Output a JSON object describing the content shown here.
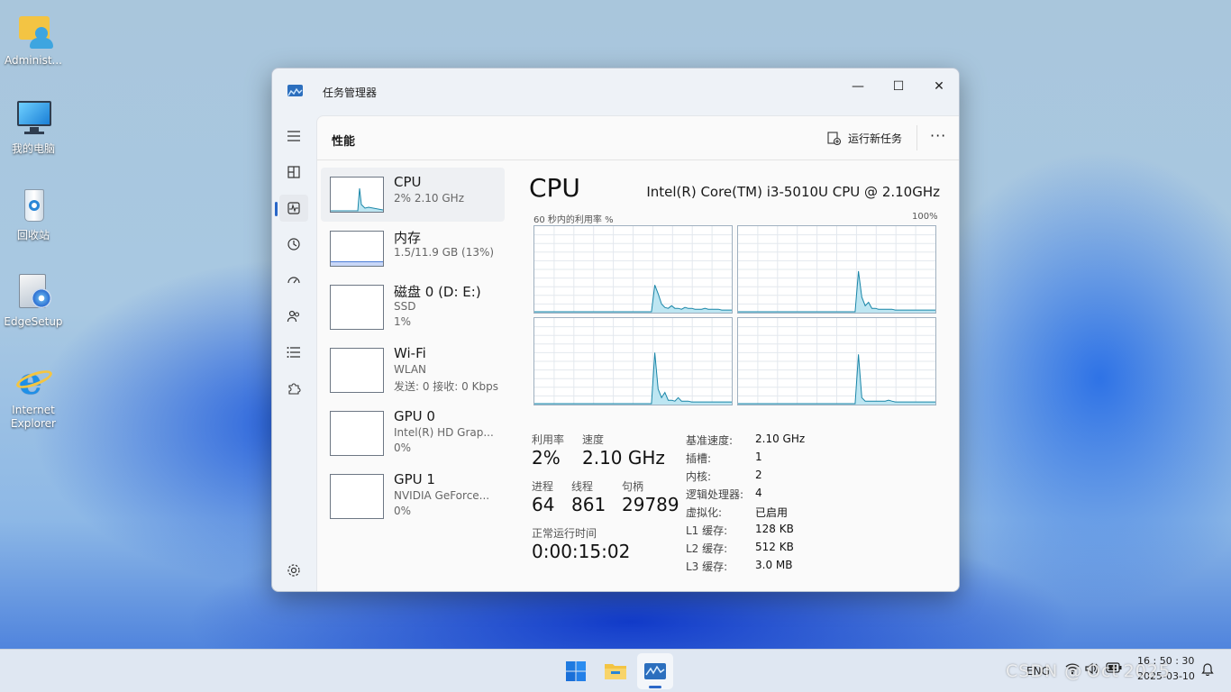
{
  "desktop": {
    "icons": [
      {
        "label": "Administ..."
      },
      {
        "label": "我的电脑"
      },
      {
        "label": "回收站"
      },
      {
        "label": "EdgeSetup"
      },
      {
        "label": "Internet Explorer"
      }
    ]
  },
  "window": {
    "title": "任务管理器",
    "controls": {
      "minimize": "—",
      "maximize": "☐",
      "close": "✕"
    }
  },
  "header": {
    "section_title": "性能",
    "run_new_task": "运行新任务",
    "more": "···"
  },
  "devices": [
    {
      "name": "CPU",
      "line1": "2% 2.10 GHz",
      "line2": ""
    },
    {
      "name": "内存",
      "line1": "1.5/11.9 GB (13%)",
      "line2": ""
    },
    {
      "name": "磁盘 0 (D: E:)",
      "line1": "SSD",
      "line2": "1%"
    },
    {
      "name": "Wi-Fi",
      "line1": "WLAN",
      "line2": "发送: 0 接收: 0 Kbps"
    },
    {
      "name": "GPU 0",
      "line1": "Intel(R) HD Grap...",
      "line2": "0%"
    },
    {
      "name": "GPU 1",
      "line1": "NVIDIA GeForce...",
      "line2": "0%"
    }
  ],
  "main": {
    "title": "CPU",
    "model": "Intel(R) Core(TM) i3-5010U CPU @ 2.10GHz",
    "graph_label_left": "60 秒内的利用率 %",
    "graph_label_right": "100%",
    "stats": {
      "utilization_label": "利用率",
      "utilization": "2%",
      "speed_label": "速度",
      "speed": "2.10 GHz",
      "processes_label": "进程",
      "processes": "64",
      "threads_label": "线程",
      "threads": "861",
      "handles_label": "句柄",
      "handles": "29789",
      "uptime_label": "正常运行时间",
      "uptime": "0:00:15:02"
    },
    "details": [
      {
        "k": "基准速度:",
        "v": "2.10 GHz"
      },
      {
        "k": "插槽:",
        "v": "1"
      },
      {
        "k": "内核:",
        "v": "2"
      },
      {
        "k": "逻辑处理器:",
        "v": "4"
      },
      {
        "k": "虚拟化:",
        "v": "已启用"
      },
      {
        "k": "L1 缓存:",
        "v": "128 KB"
      },
      {
        "k": "L2 缓存:",
        "v": "512 KB"
      },
      {
        "k": "L3 缓存:",
        "v": "3.0 MB"
      }
    ]
  },
  "taskbar": {
    "lang": "ENG",
    "time": "16 : 50 : 30",
    "date": "2025-03-10",
    "watermark": "CSDN @ Oct 2025"
  },
  "colors": {
    "accent": "#2a67c8",
    "graph_fill": "#bde6f2",
    "graph_line": "#1a86a8"
  }
}
